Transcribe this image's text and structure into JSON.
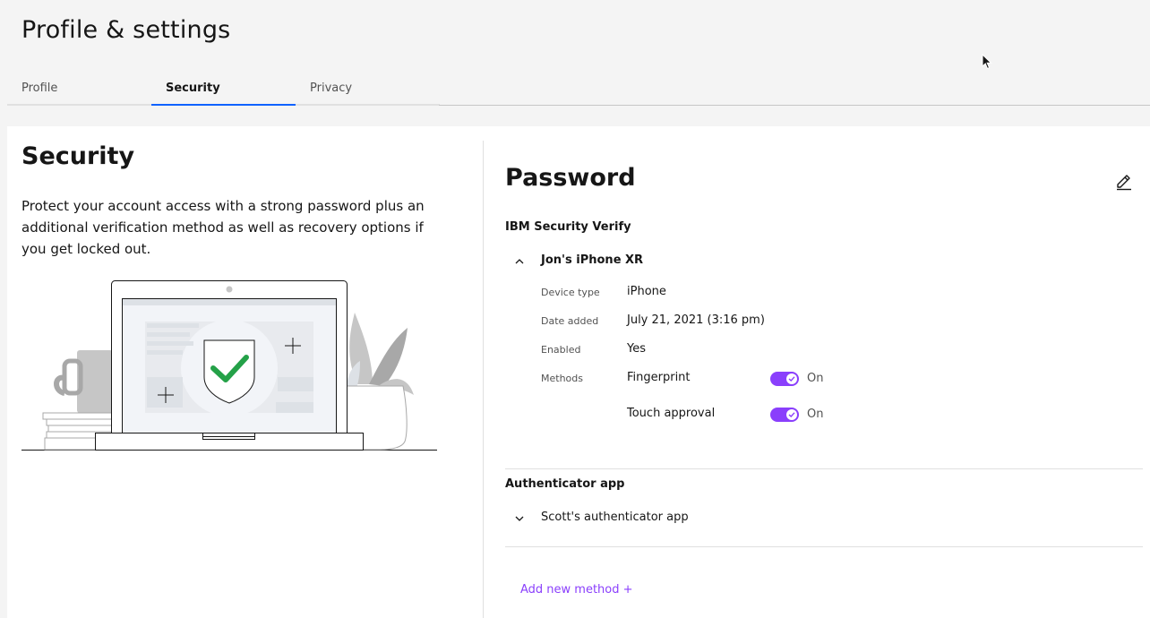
{
  "page": {
    "title": "Profile & settings"
  },
  "tabs": [
    {
      "label": "Profile",
      "active": false
    },
    {
      "label": "Security",
      "active": true
    },
    {
      "label": "Privacy",
      "active": false
    }
  ],
  "security": {
    "title": "Security",
    "description": "Protect your account access with a strong password plus an additional verification method as well as recovery options if you get locked out."
  },
  "password": {
    "title": "Password",
    "edit_icon": "pencil-icon"
  },
  "ibm_verify": {
    "title": "IBM Security Verify",
    "device": {
      "name": "Jon's iPhone XR",
      "expanded": true,
      "props": {
        "device_type_label": "Device type",
        "device_type_value": "iPhone",
        "date_added_label": "Date added",
        "date_added_value": "July 21, 2021 (3:16 pm)",
        "enabled_label": "Enabled",
        "enabled_value": "Yes",
        "methods_label": "Methods"
      },
      "methods": [
        {
          "name": "Fingerprint",
          "state": "On"
        },
        {
          "name": "Touch approval",
          "state": "On"
        }
      ]
    }
  },
  "authenticator": {
    "title": "Authenticator app",
    "app": {
      "name": "Scott's authenticator app",
      "expanded": false
    }
  },
  "add_method": {
    "label": "Add new method +"
  },
  "colors": {
    "accent": "#8a3ffc",
    "tab_active": "#0f62fe",
    "check_green": "#24a148"
  }
}
